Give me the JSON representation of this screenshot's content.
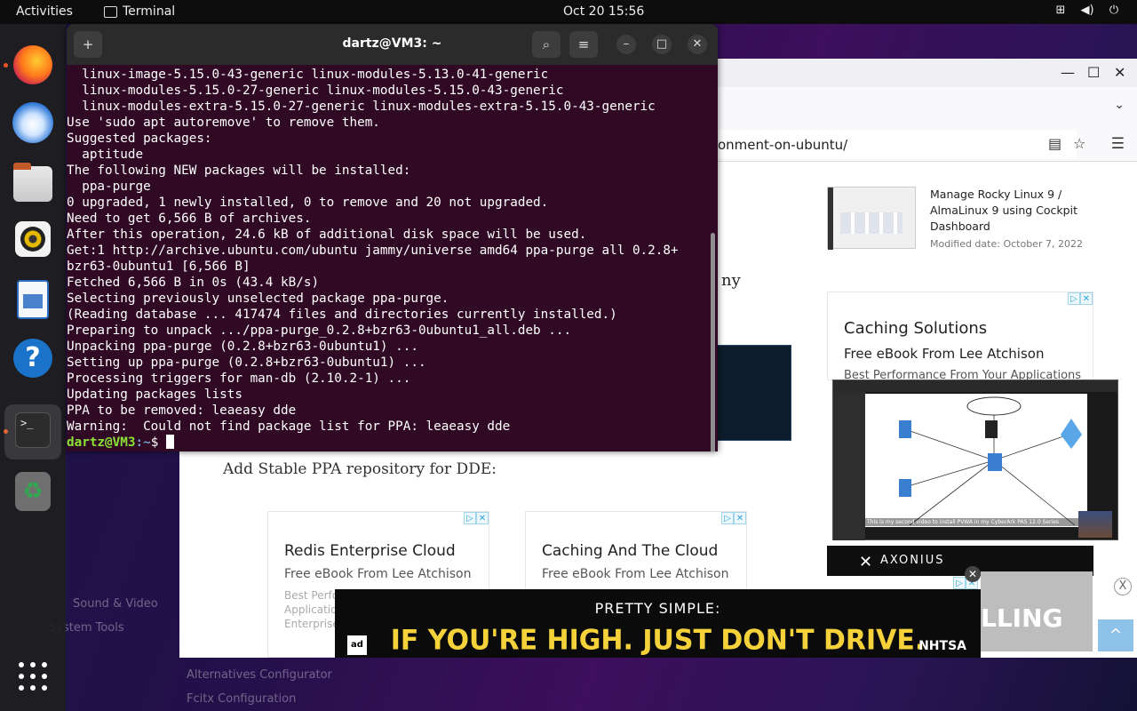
{
  "topbar": {
    "activities": "Activities",
    "app_name": "Terminal",
    "clock": "Oct 20  15:56"
  },
  "dock": {
    "items": [
      "firefox-icon",
      "thunderbird-icon",
      "files-icon",
      "rhythmbox-icon",
      "writer-icon",
      "help-icon",
      "terminal-icon",
      "trash-icon"
    ],
    "terminal_glyph": ">_"
  },
  "terminal": {
    "title": "dartz@VM3: ~",
    "lines": [
      "  linux-image-5.15.0-43-generic linux-modules-5.13.0-41-generic",
      "  linux-modules-5.15.0-27-generic linux-modules-5.15.0-43-generic",
      "  linux-modules-extra-5.15.0-27-generic linux-modules-extra-5.15.0-43-generic",
      "Use 'sudo apt autoremove' to remove them.",
      "Suggested packages:",
      "  aptitude",
      "The following NEW packages will be installed:",
      "  ppa-purge",
      "0 upgraded, 1 newly installed, 0 to remove and 20 not upgraded.",
      "Need to get 6,566 B of archives.",
      "After this operation, 24.6 kB of additional disk space will be used.",
      "Get:1 http://archive.ubuntu.com/ubuntu jammy/universe amd64 ppa-purge all 0.2.8+",
      "bzr63-0ubuntu1 [6,566 B]",
      "Fetched 6,566 B in 0s (43.4 kB/s)",
      "Selecting previously unselected package ppa-purge.",
      "(Reading database ... 417474 files and directories currently installed.)",
      "Preparing to unpack .../ppa-purge_0.2.8+bzr63-0ubuntu1_all.deb ...",
      "Unpacking ppa-purge (0.2.8+bzr63-0ubuntu1) ...",
      "Setting up ppa-purge (0.2.8+bzr63-0ubuntu1) ...",
      "Processing triggers for man-db (2.10.2-1) ...",
      "Updating packages lists",
      "PPA to be removed: leaeasy dde",
      "Warning:  Could not find package list for PPA: leaeasy dde"
    ],
    "prompt_user": "dartz@VM3",
    "prompt_path": ":~",
    "prompt_symbol": "$"
  },
  "browser": {
    "url_partial": "onment-on-ubuntu/",
    "article_fragment": "ny",
    "add_ppa_text": "Add Stable PPA repository for DDE:",
    "sidebar_post": {
      "title": "Manage Rocky Linux 9 / AlmaLinux 9 using Cockpit Dashboard",
      "date": "Modified date: October 7, 2022"
    },
    "side_ad": {
      "title": "Caching Solutions",
      "subtitle": "Free eBook From Lee Atchison",
      "line3": "Best Performance From Your Applications"
    },
    "video_caption": "This is my second video to install PVWA in my CyberArk PAS 12.0 Series",
    "axonius": "AXONIUS",
    "ad_cards": [
      {
        "title": "Redis Enterprise Cloud",
        "subtitle": "Free eBook From Lee Atchison",
        "faded": "Best Perfo\nApplicatio\nEnterprise"
      },
      {
        "title": "Caching And The Cloud",
        "subtitle": "Free eBook From Lee Atchison",
        "faded": ""
      }
    ],
    "banner": {
      "pretty": "PRETTY SIMPLE:",
      "headline": "IF YOU'RE HIGH. JUST DON'T DRIVE.",
      "adc": "ad",
      "nhtsa": "NHTSA"
    },
    "gray_ad_text": "LLING"
  },
  "ghost_menu": {
    "items": [
      "Sound & Video",
      "System Tools",
      "Alternatives Configurator",
      "Fcitx Configuration"
    ]
  }
}
